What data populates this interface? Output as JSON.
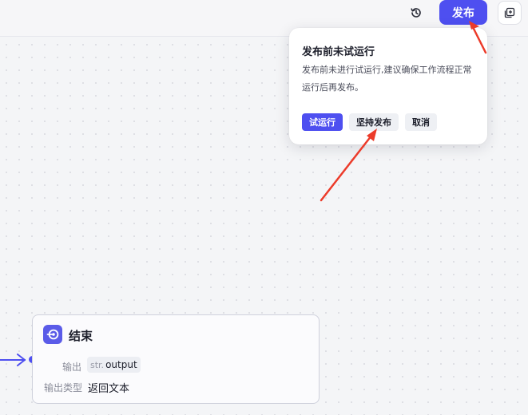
{
  "toolbar": {
    "history_icon": "history-icon",
    "publish_label": "发布",
    "copy_icon": "copy-icon"
  },
  "colors": {
    "accent": "#4e4ff0",
    "annotation_arrow": "#ec3b2a"
  },
  "popover": {
    "title": "发布前未试运行",
    "description": "发布前未进行试运行,建议确保工作流程正常运行后再发布。",
    "buttons": {
      "test_run": "试运行",
      "force_publish": "坚持发布",
      "cancel": "取消"
    }
  },
  "end_node": {
    "icon": "end-node-icon",
    "title": "结束",
    "output_label": "输出",
    "output_type_tag": "str.",
    "output_value": "output",
    "output_kind_label": "输出类型",
    "output_kind_value": "返回文本"
  }
}
